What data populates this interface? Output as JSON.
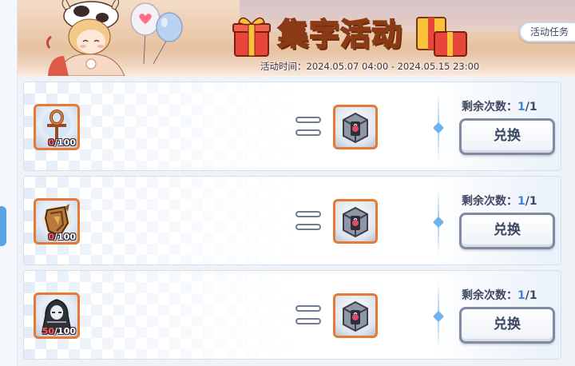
{
  "banner": {
    "title": "集字活动",
    "time_label": "活动时间：",
    "time_range": "2024.05.07 04:00 - 2024.05.15 23:00",
    "task_button": "活动任务"
  },
  "rows": [
    {
      "item_icon": "ankh-icon",
      "item_have": "0",
      "item_need": "/100",
      "reward_icon": "treasure-box-icon",
      "remain_label": "剩余次数：",
      "remain_current": "1",
      "remain_total": "/1",
      "button": "兑换"
    },
    {
      "item_icon": "armor-shard-icon",
      "item_have": "0",
      "item_need": "/100",
      "reward_icon": "treasure-box-icon",
      "remain_label": "剩余次数：",
      "remain_current": "1",
      "remain_total": "/1",
      "button": "兑换"
    },
    {
      "item_icon": "hooded-figure-icon",
      "item_have": "50",
      "item_need": "/100",
      "reward_icon": "treasure-box-icon",
      "remain_label": "剩余次数：",
      "remain_current": "1",
      "remain_total": "/1",
      "button": "兑换"
    }
  ],
  "colors": {
    "slot_border": "#e67a35",
    "count_have": "#ff5a4f",
    "remain_current": "#3d86d9",
    "title_fill": "#f9c23a"
  }
}
